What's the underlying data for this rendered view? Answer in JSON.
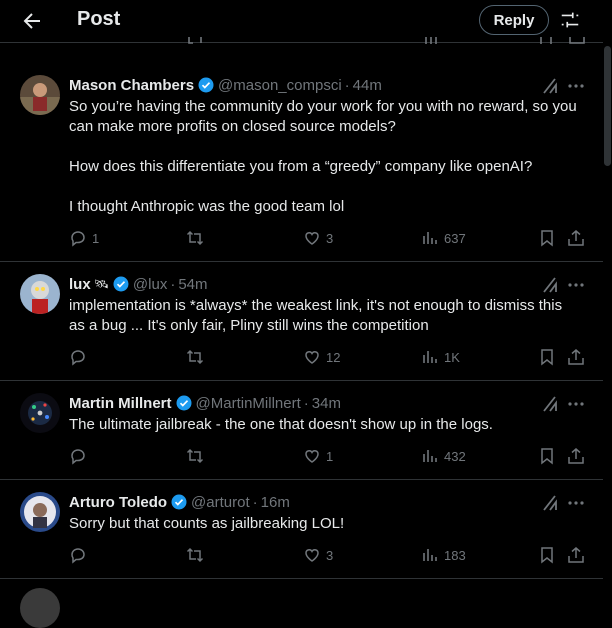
{
  "header": {
    "title": "Post",
    "reply_label": "Reply"
  },
  "colors": {
    "background": "#000000",
    "text": "#e7e9ea",
    "muted": "#71767b",
    "border": "#2f3336",
    "verified": "#1d9bf0"
  },
  "icons": {
    "back": "arrow-left-icon",
    "filter": "sliders-icon",
    "grok": "grok-icon",
    "more": "ellipsis-icon",
    "reply": "reply-bubble-icon",
    "repost": "repost-icon",
    "like": "heart-icon",
    "views": "bar-chart-icon",
    "bookmark": "bookmark-icon",
    "share": "share-icon",
    "verified": "verified-badge-icon"
  },
  "posts": [
    {
      "name": "Mason Chambers",
      "handle": "@mason_compsci",
      "time": "44m",
      "text": [
        "So you’re having the community do your work for you with no reward, so you can make more profits on closed source models?",
        "How does this differentiate you from a “greedy” company like openAI?",
        "I thought Anthropic was the good team lol"
      ],
      "replies": "1",
      "reposts": "",
      "likes": "3",
      "views": "637"
    },
    {
      "name": "lux",
      "emoji": "🛰",
      "handle": "@lux",
      "time": "54m",
      "text": [
        "implementation is *always* the weakest link, it's not enough to dismiss this as a bug ...  It's only fair, Pliny still wins the competition"
      ],
      "replies": "",
      "reposts": "",
      "likes": "12",
      "views": "1K"
    },
    {
      "name": "Martin Millnert",
      "handle": "@MartinMillnert",
      "time": "34m",
      "text": [
        "The ultimate jailbreak - the one that doesn't show up in the logs."
      ],
      "replies": "",
      "reposts": "",
      "likes": "1",
      "views": "432"
    },
    {
      "name": "Arturo Toledo",
      "handle": "@arturot",
      "time": "16m",
      "text": [
        "Sorry but that counts as jailbreaking LOL!"
      ],
      "replies": "",
      "reposts": "",
      "likes": "3",
      "views": "183"
    }
  ]
}
